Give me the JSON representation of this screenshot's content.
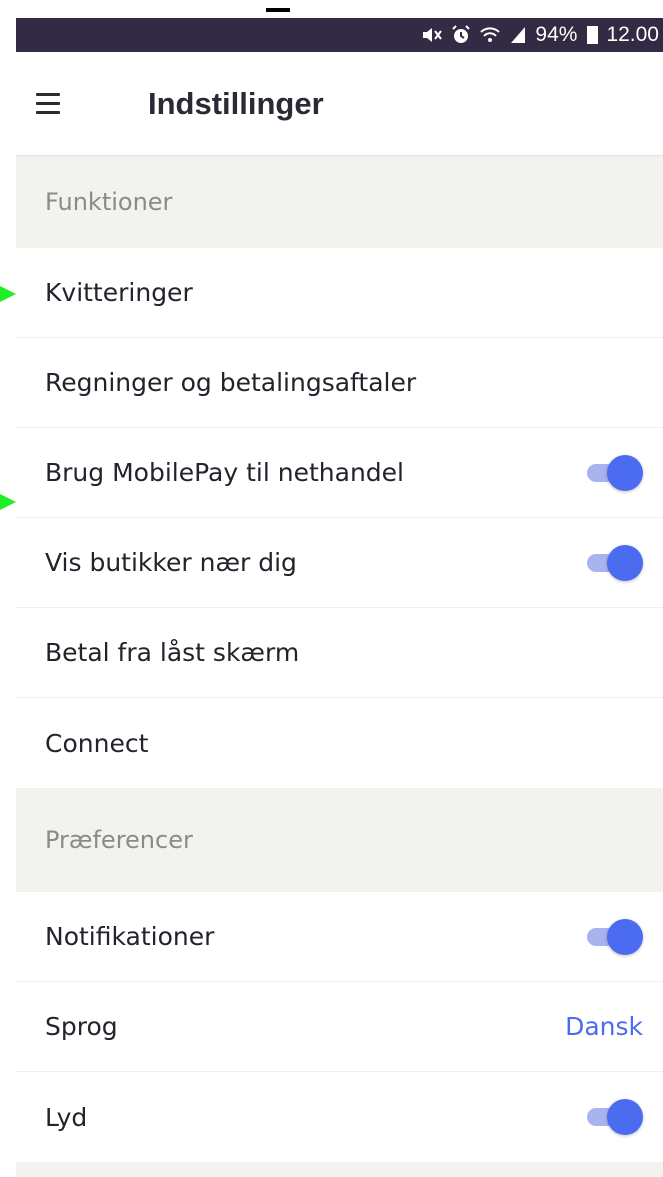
{
  "status_bar": {
    "battery_percent": "94%",
    "time": "12.00",
    "icons": [
      "mute-icon",
      "alarm-icon",
      "wifi-icon",
      "signal-icon",
      "battery-icon"
    ],
    "background": "#332b43"
  },
  "header": {
    "menu_icon": "hamburger-menu-icon",
    "title": "Indstillinger"
  },
  "sections": [
    {
      "title": "Funktioner",
      "items": [
        {
          "label": "Kvitteringer"
        },
        {
          "label": "Regninger og betalingsaftaler"
        },
        {
          "label": "Brug MobilePay til nethandel",
          "toggle": true
        },
        {
          "label": "Vis butikker nær dig",
          "toggle": true
        },
        {
          "label": "Betal fra låst skærm"
        },
        {
          "label": "Connect"
        }
      ]
    },
    {
      "title": "Præferencer",
      "items": [
        {
          "label": "Notifikationer",
          "toggle": true
        },
        {
          "label": "Sprog",
          "value": "Dansk"
        },
        {
          "label": "Lyd",
          "toggle": true
        }
      ]
    }
  ],
  "colors": {
    "accent": "#4b6cf0",
    "toggle_track": "#a9b3ef",
    "section_bg": "#f2f2ef",
    "text": "#23232b"
  }
}
